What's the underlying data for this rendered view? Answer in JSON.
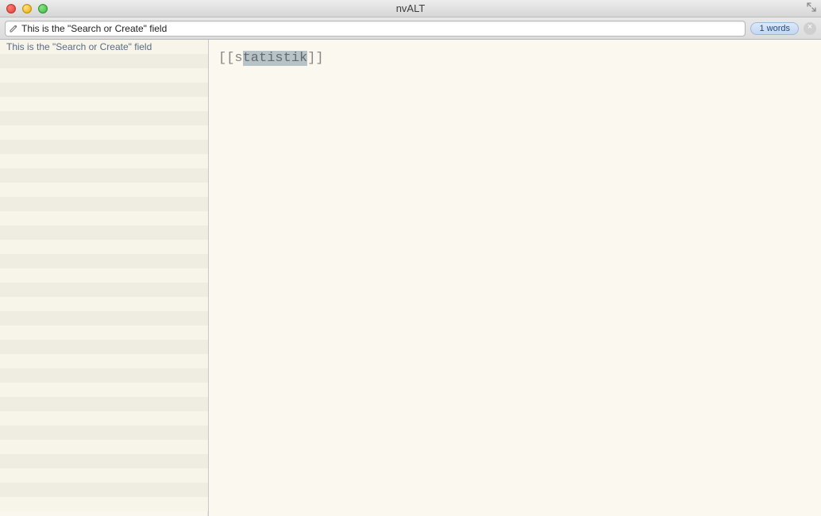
{
  "window": {
    "title": "nvALT"
  },
  "toolbar": {
    "search_value": "This is the \"Search or Create\" field",
    "search_placeholder": "Search or Create",
    "word_count_label": "1 words",
    "clear_label": "×"
  },
  "sidebar": {
    "selected_index": 0,
    "items": [
      {
        "title": "This is the \"Search or Create\" field"
      }
    ],
    "visible_rows": 33
  },
  "editor": {
    "raw": "[[statistik]]",
    "prefix": "[[s",
    "selection": "tatistik",
    "suffix": "]]"
  },
  "colors": {
    "editor_bg": "#fbf8f0",
    "sidebar_bg": "#faf7ef",
    "selection_bg": "#b7c3c6"
  }
}
